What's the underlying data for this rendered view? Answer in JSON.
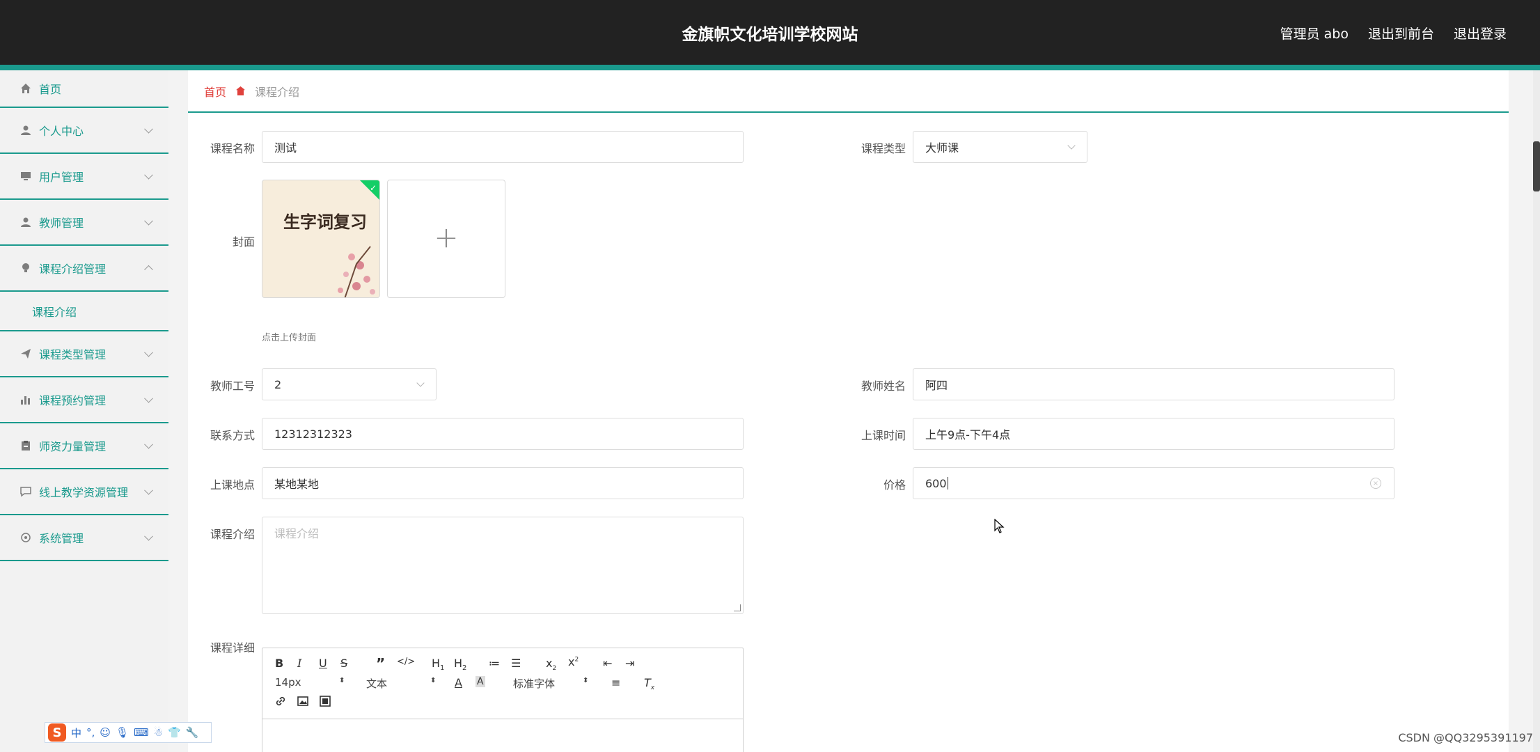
{
  "header": {
    "title": "金旗帜文化培训学校网站",
    "user": "管理员 abo",
    "to_front": "退出到前台",
    "logout": "退出登录"
  },
  "sidebar": {
    "items": [
      {
        "label": "首页",
        "icon": "home-icon"
      },
      {
        "label": "个人中心",
        "icon": "user-icon"
      },
      {
        "label": "用户管理",
        "icon": "monitor-icon"
      },
      {
        "label": "教师管理",
        "icon": "user-icon"
      },
      {
        "label": "课程介绍管理",
        "icon": "bulb-icon"
      },
      {
        "label": "课程介绍",
        "icon": ""
      },
      {
        "label": "课程类型管理",
        "icon": "send-icon"
      },
      {
        "label": "课程预约管理",
        "icon": "chart-icon"
      },
      {
        "label": "师资力量管理",
        "icon": "clipboard-icon"
      },
      {
        "label": "线上教学资源管理",
        "icon": "chat-icon"
      },
      {
        "label": "系统管理",
        "icon": "settings-icon"
      }
    ]
  },
  "breadcrumb": {
    "home": "首页",
    "current": "课程介绍"
  },
  "form": {
    "course_name": {
      "label": "课程名称",
      "value": "测试"
    },
    "course_type": {
      "label": "课程类型",
      "value": "大师课"
    },
    "cover": {
      "label": "封面",
      "image_text": "生字词复习",
      "hint": "点击上传封面"
    },
    "teacher_id": {
      "label": "教师工号",
      "value": "2"
    },
    "teacher_name": {
      "label": "教师姓名",
      "value": "阿四"
    },
    "contact": {
      "label": "联系方式",
      "value": "12312312323"
    },
    "class_time": {
      "label": "上课时间",
      "value": "上午9点-下午4点"
    },
    "location": {
      "label": "上课地点",
      "value": "某地某地"
    },
    "price": {
      "label": "价格",
      "value": "600"
    },
    "intro": {
      "label": "课程介绍",
      "placeholder": "课程介绍"
    },
    "detail": {
      "label": "课程详细"
    }
  },
  "editor": {
    "font_size": "14px",
    "block_type": "文本",
    "font_family": "标准字体"
  },
  "ime": {
    "mode": "中"
  },
  "watermark": "CSDN @QQ3295391197"
}
